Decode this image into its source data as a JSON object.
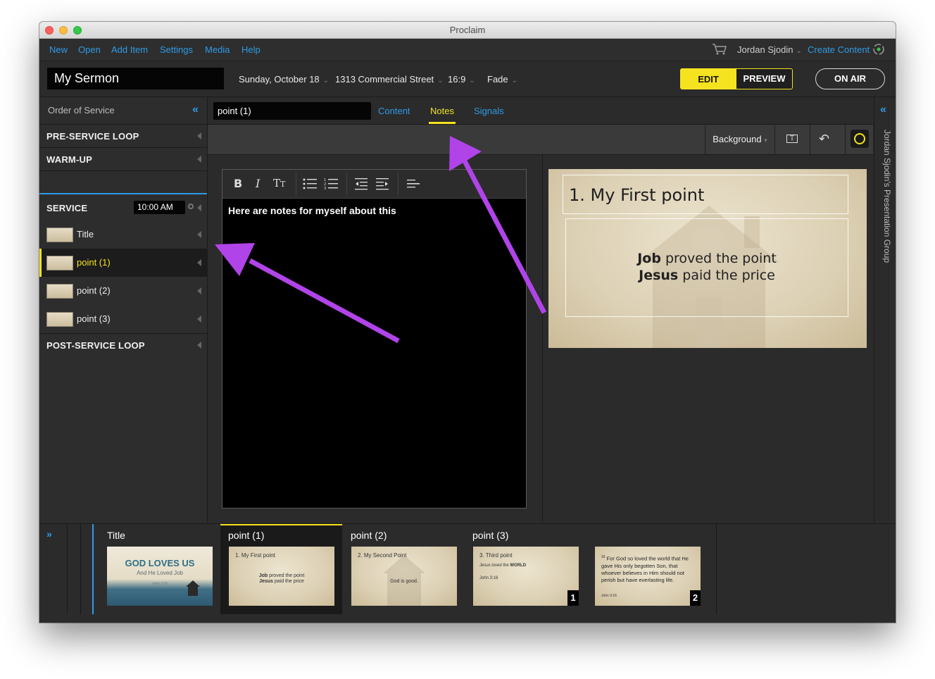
{
  "window": {
    "title": "Proclaim"
  },
  "menubar": {
    "items": [
      "New",
      "Open",
      "Add Item",
      "Settings",
      "Media",
      "Help"
    ],
    "user": "Jordan Sjodin",
    "create_content": "Create Content"
  },
  "header": {
    "presentation_title": "My Sermon",
    "date": "Sunday, October 18",
    "location": "1313 Commercial Street",
    "aspect": "16:9",
    "transition": "Fade",
    "edit_label": "EDIT",
    "preview_label": "PREVIEW",
    "onair_label": "ON AIR"
  },
  "sidebar": {
    "title": "Order of Service",
    "sections": {
      "pre": "PRE-SERVICE LOOP",
      "warmup": "WARM-UP",
      "service": "SERVICE",
      "service_time": "10:00 AM",
      "post": "POST-SERVICE LOOP"
    },
    "items": [
      {
        "label": "Title"
      },
      {
        "label": "point (1)"
      },
      {
        "label": "point (2)"
      },
      {
        "label": "point (3)"
      }
    ]
  },
  "editor": {
    "item_name": "point (1)",
    "tabs": [
      "Content",
      "Notes",
      "Signals"
    ],
    "active_tab": "Notes",
    "background_label": "Background",
    "notes_text": "Here are notes for myself about this"
  },
  "slide": {
    "title": "1. My First point",
    "line1_bold": "Job",
    "line1_rest": " proved the point",
    "line2_bold": "Jesus",
    "line2_rest": " paid the price"
  },
  "right_panel": {
    "label": "Jordan Sjodin's Presentation Group"
  },
  "bottom_strip": {
    "groups": [
      {
        "label": "Title"
      },
      {
        "label": "point (1)"
      },
      {
        "label": "point (2)"
      },
      {
        "label": "point (3)"
      }
    ],
    "thumbs": {
      "title_main": "GOD LOVES US",
      "title_sub": "And He Loved Job",
      "title_ref": "John 3:16",
      "p1_title": "1. My First point",
      "p1_l1_bold": "Job",
      "p1_l1": " proved the point",
      "p1_l2_bold": "Jesus",
      "p1_l2": " paid the price",
      "p2_title": "2. My Second Point",
      "p2_body": "God is good.",
      "p3_title": "3. Third point",
      "p3_body": "Jesus loved the",
      "p3_body_bold": "WORLD",
      "p3_ref": "John 3:16",
      "p3_badge": "1",
      "p4_sup": "16",
      "p4_text": " For God so loved the world that He gave His only begotten Son, that whoever believes in Him should not perish but have everlasting life.",
      "p4_ref": "John 3:16",
      "p4_badge": "2"
    }
  },
  "colors": {
    "accent_yellow": "#f5e31f",
    "link_blue": "#2f9be6",
    "annotation_arrow": "#b044e8"
  }
}
